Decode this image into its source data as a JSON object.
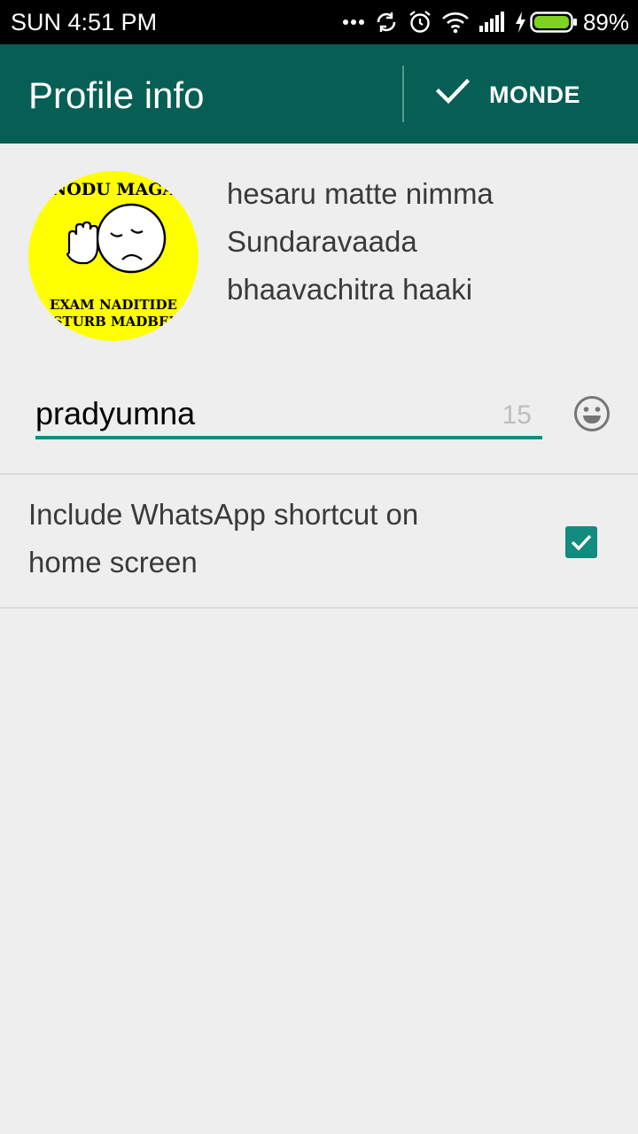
{
  "status_bar": {
    "time": "SUN 4:51 PM",
    "battery_percent": "89%",
    "icons": [
      "more-dots-icon",
      "sync-icon",
      "alarm-icon",
      "wifi-icon",
      "signal-icon",
      "charging-icon",
      "battery-icon"
    ]
  },
  "app_bar": {
    "title": "Profile info",
    "done_label": "MONDE",
    "done_icon": "check-icon",
    "background": "#075e54"
  },
  "profile": {
    "photo": {
      "top_text": "NODU MAGA",
      "bottom_text_1": "EXAM NADITIDE",
      "bottom_text_2": "ISTURB MADBED",
      "background": "#ffff00"
    },
    "prompt_lines": [
      "hesaru matte nimma",
      "Sundaravaada",
      "bhaavachitra haaki"
    ]
  },
  "name_field": {
    "value": "pradyumna",
    "remaining_chars": "15",
    "emoji_icon": "emoji-icon",
    "accent": "#128c7e"
  },
  "shortcut_option": {
    "label_line_1": "Include WhatsApp shortcut on",
    "label_line_2": "home screen",
    "checked": true
  }
}
